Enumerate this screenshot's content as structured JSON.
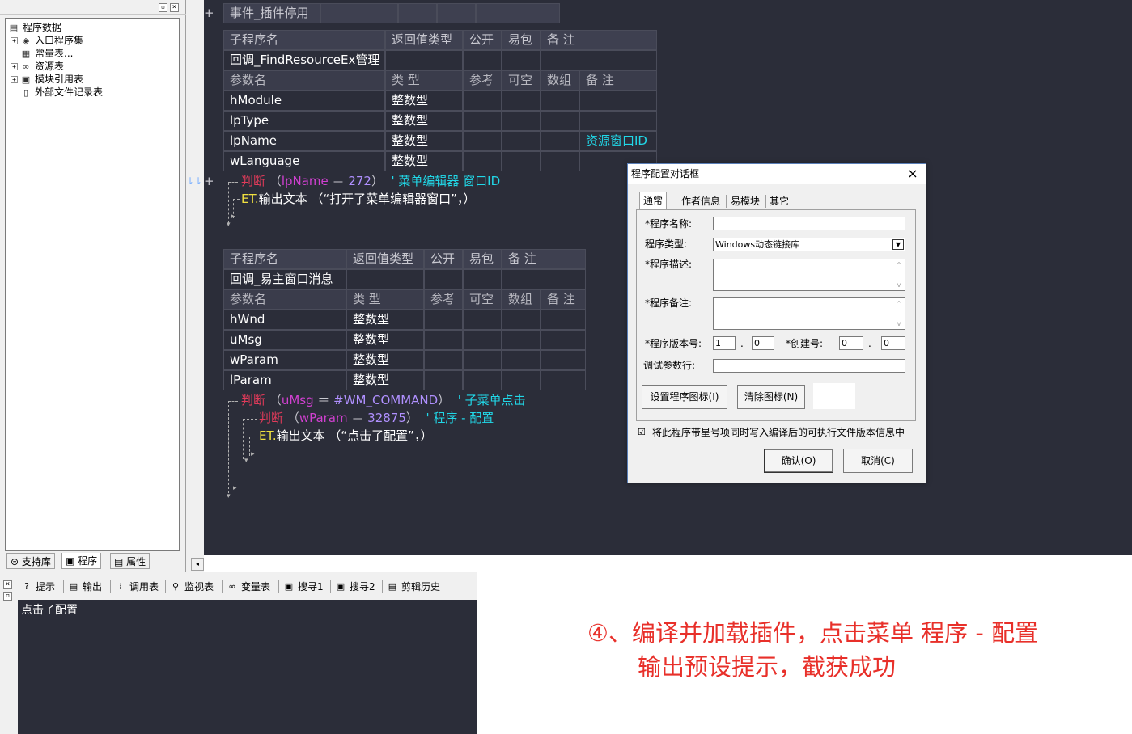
{
  "left_panel": {
    "minimize_glyph": "▫",
    "close_glyph": "×",
    "tree": [
      {
        "label": "程序数据",
        "icon": "program-data-icon",
        "expander": ""
      },
      {
        "label": "入口程序集",
        "icon": "assembly-icon",
        "expander": "+"
      },
      {
        "label": "常量表...",
        "icon": "constant-icon",
        "expander": ""
      },
      {
        "label": "资源表",
        "icon": "resource-icon",
        "expander": "+"
      },
      {
        "label": "模块引用表",
        "icon": "module-icon",
        "expander": "+"
      },
      {
        "label": "外部文件记录表",
        "icon": "file-icon",
        "expander": ""
      }
    ],
    "tabs": [
      "支持库",
      "程序",
      "属性"
    ]
  },
  "editor": {
    "top_block": {
      "plus": "+",
      "title": "事件_插件停用"
    },
    "sub1": {
      "headers": [
        "子程序名",
        "返回值类型",
        "公开",
        "易包",
        "备 注"
      ],
      "name": "回调_FindResourceEx管理",
      "param_headers": [
        "参数名",
        "类 型",
        "参考",
        "可空",
        "数组",
        "备 注"
      ],
      "params": [
        {
          "name": "hModule",
          "type": "整数型",
          "note": ""
        },
        {
          "name": "lpType",
          "type": "整数型",
          "note": ""
        },
        {
          "name": "lpName",
          "type": "整数型",
          "note": "资源窗口ID"
        },
        {
          "name": "wLanguage",
          "type": "整数型",
          "note": ""
        }
      ],
      "gutter_marker": "⇂⇂",
      "plus": "+",
      "code": [
        {
          "kw": "判断",
          "paren_open": "（",
          "var": "lpName",
          "op": " ＝ ",
          "num": "272",
          "paren_close": "）",
          "comment": "' 菜单编辑器  窗口ID"
        },
        {
          "et": "ET.",
          "text": "输出文本 （“打开了菜单编辑器窗口”，）"
        }
      ]
    },
    "sub2": {
      "headers": [
        "子程序名",
        "返回值类型",
        "公开",
        "易包",
        "备 注"
      ],
      "name": "回调_易主窗口消息",
      "param_headers": [
        "参数名",
        "类 型",
        "参考",
        "可空",
        "数组",
        "备 注"
      ],
      "params": [
        {
          "name": "hWnd",
          "type": "整数型"
        },
        {
          "name": "uMsg",
          "type": "整数型"
        },
        {
          "name": "wParam",
          "type": "整数型"
        },
        {
          "name": "lParam",
          "type": "整数型"
        }
      ],
      "code": [
        {
          "kw": "判断",
          "paren_open": "（",
          "var": "uMsg",
          "op": " ＝ ",
          "num": "#WM_COMMAND",
          "paren_close": "）",
          "comment": "' 子菜单点击"
        },
        {
          "kw": "判断",
          "paren_open": "（",
          "var": "wParam",
          "op": " ＝ ",
          "num": "32875",
          "paren_close": "）",
          "comment": "' 程序 - 配置"
        },
        {
          "et": "ET.",
          "text": "输出文本 （“点击了配置”，）"
        }
      ]
    }
  },
  "bottom": {
    "tabs": [
      {
        "label": "提示",
        "icon": "hint-icon"
      },
      {
        "label": "输出",
        "icon": "output-icon"
      },
      {
        "label": "调用表",
        "icon": "call-table-icon"
      },
      {
        "label": "监视表",
        "icon": "watch-icon"
      },
      {
        "label": "变量表",
        "icon": "variable-icon"
      },
      {
        "label": "搜寻1",
        "icon": "search1-icon"
      },
      {
        "label": "搜寻2",
        "icon": "search2-icon"
      },
      {
        "label": "剪辑历史",
        "icon": "clipboard-icon"
      }
    ],
    "output_text": "点击了配置"
  },
  "annotation": {
    "line1": "④、编译并加载插件，点击菜单 程序 - 配置",
    "line2": "输出预设提示，截获成功"
  },
  "dialog": {
    "title": "程序配置对话框",
    "close": "×",
    "tabs": [
      "通常",
      "作者信息",
      "易模块",
      "其它"
    ],
    "fields": {
      "name_label": "*程序名称:",
      "name_value": "",
      "type_label": "程序类型:",
      "type_value": "Windows动态链接库",
      "desc_label": "*程序描述:",
      "note_label": "*程序备注:",
      "version_label": "*程序版本号:",
      "version_major": "1",
      "version_minor": "0",
      "version_dot": ".",
      "build_label": "*创建号:",
      "build_major": "0",
      "build_minor": "0",
      "debug_label": "调试参数行:",
      "debug_value": ""
    },
    "set_icon_button": "设置程序图标(I)",
    "clear_icon_button": "清除图标(N)",
    "checkbox_checked": "☑",
    "checkbox_label": "将此程序带星号项同时写入编译后的可执行文件版本信息中",
    "ok_button": "确认(O)",
    "cancel_button": "取消(C)"
  }
}
